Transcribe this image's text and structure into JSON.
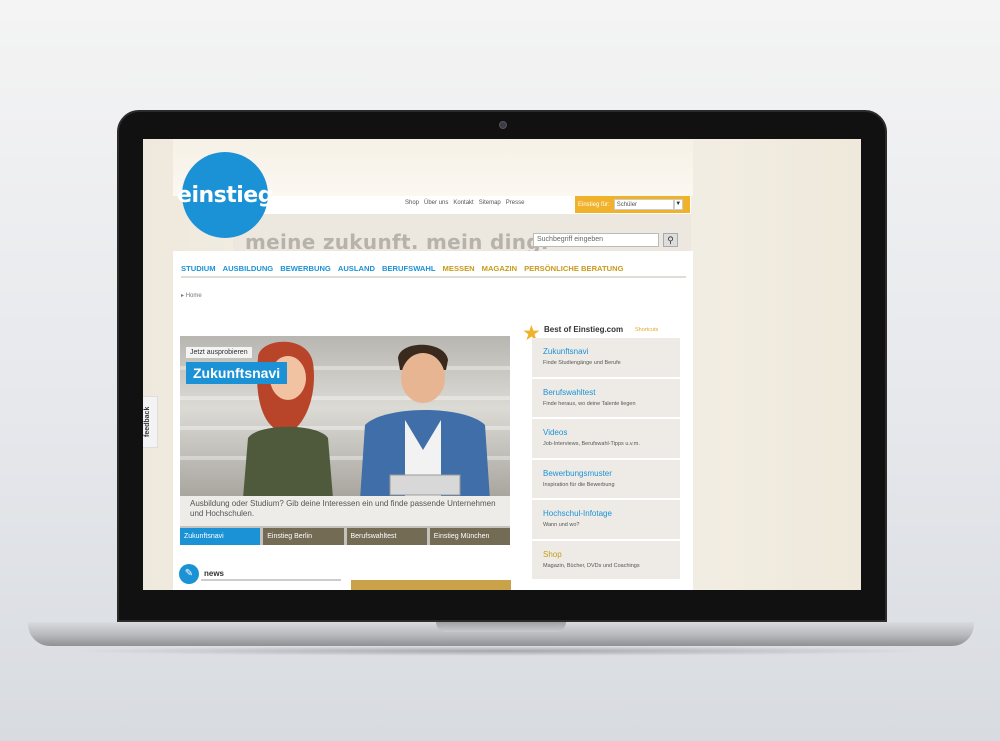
{
  "site": {
    "logo_text": "einstieg",
    "slogan": "meine zukunft. mein ding."
  },
  "topbar": {
    "links": [
      "Shop",
      "Über uns",
      "Kontakt",
      "Sitemap",
      "Presse"
    ],
    "select_label": "Einstieg für:",
    "select_value": "Schüler"
  },
  "search": {
    "placeholder": "Suchbegriff eingeben"
  },
  "mainnav": [
    {
      "label": "STUDIUM",
      "color": "#1b92d6"
    },
    {
      "label": "AUSBILDUNG",
      "color": "#1b92d6"
    },
    {
      "label": "BEWERBUNG",
      "color": "#1b92d6"
    },
    {
      "label": "AUSLAND",
      "color": "#1b92d6"
    },
    {
      "label": "BERUFSWAHL",
      "color": "#1b92d6"
    },
    {
      "label": "MESSEN",
      "color": "#c79a1a"
    },
    {
      "label": "MAGAZIN",
      "color": "#c79a1a"
    },
    {
      "label": "PERSÖNLICHE BERATUNG",
      "color": "#c79a1a"
    }
  ],
  "breadcrumb": "Home",
  "teaser": {
    "tag": "Jetzt ausprobieren",
    "title": "Zukunftsnavi",
    "text": "Ausbildung oder Studium? Gib deine Interessen ein und finde passende Unternehmen und Hochschulen.",
    "tabs": [
      "Zukunftsnavi",
      "Einstieg Berlin",
      "Berufswahltest",
      "Einstieg München"
    ]
  },
  "news": {
    "label": "news"
  },
  "bestof": {
    "title": "Best of Einstieg.com",
    "subtitle": "Shortcuts",
    "items": [
      {
        "title": "Zukunftsnavi",
        "desc": "Finde Studiengänge und Berufe"
      },
      {
        "title": "Berufswahltest",
        "desc": "Finde heraus, wo deine Talente liegen"
      },
      {
        "title": "Videos",
        "desc": "Job-Interviews, Berufswahl-Tipps u.v.m."
      },
      {
        "title": "Bewerbungsmuster",
        "desc": "Inspiration für die Bewerbung"
      },
      {
        "title": "Hochschul-Infotage",
        "desc": "Wann und wo?"
      },
      {
        "title": "Shop",
        "desc": "Magazin, Bücher, DVDs und Coachings"
      }
    ]
  },
  "feedback": "feedback"
}
